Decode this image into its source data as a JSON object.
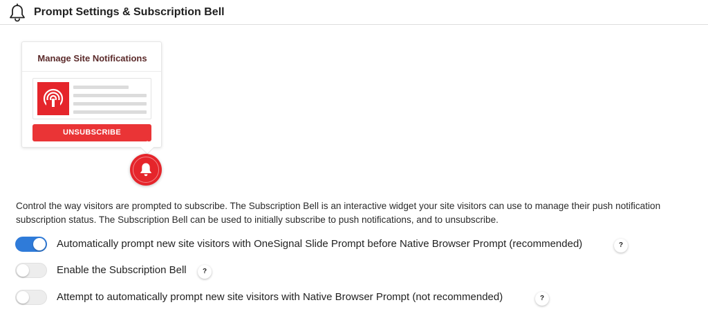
{
  "header": {
    "title": "Prompt Settings & Subscription Bell",
    "icon": "bell-icon"
  },
  "preview": {
    "title": "Manage Site Notifications",
    "button_label": "UNSUBSCRIBE",
    "logo_icon": "onesignal-logo-icon",
    "bell_icon": "bell-icon",
    "accent_color": "#e5252b"
  },
  "description": "Control the way visitors are prompted to subscribe. The Subscription Bell is an interactive widget your site visitors can use to manage their push notification subscription status. The Subscription Bell can be used to initially subscribe to push notifications, and to unsubscribe.",
  "options": [
    {
      "label": "Automatically prompt new site visitors with OneSignal Slide Prompt before Native Browser Prompt (recommended)",
      "enabled": true,
      "help": "?"
    },
    {
      "label": "Enable the Subscription Bell",
      "enabled": false,
      "help": "?"
    },
    {
      "label": "Attempt to automatically prompt new site visitors with Native Browser Prompt (not recommended)",
      "enabled": false,
      "help": "?"
    }
  ],
  "colors": {
    "toggle_on": "#2f7bd9",
    "toggle_off": "#ededed"
  }
}
